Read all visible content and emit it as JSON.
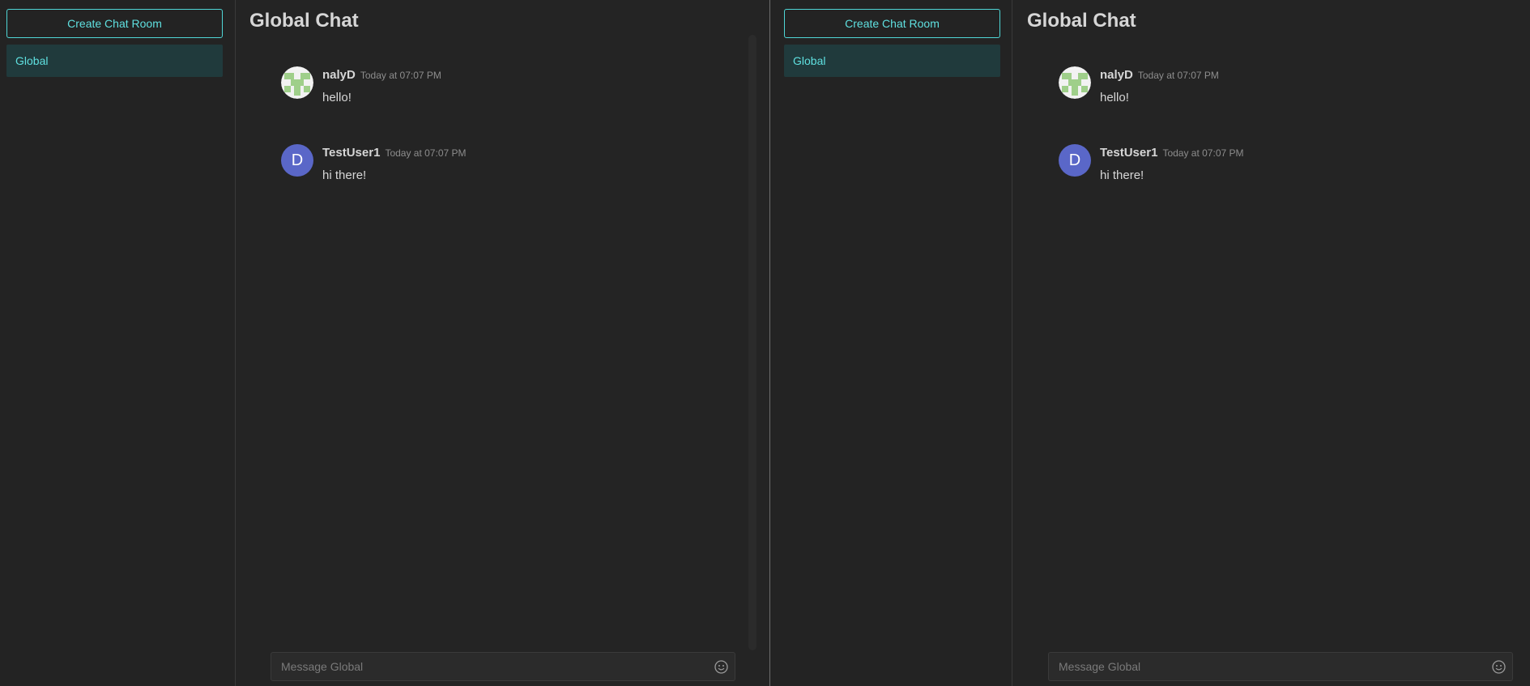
{
  "panes": [
    {
      "sidebar": {
        "create_button": "Create Chat Room",
        "rooms": [
          {
            "label": "Global"
          }
        ]
      },
      "main": {
        "title": "Global Chat",
        "messages": [
          {
            "avatar": "green-identicon",
            "user": "nalyD",
            "time": "Today at 07:07 PM",
            "text": "hello!"
          },
          {
            "avatar_letter": "D",
            "user": "TestUser1",
            "time": "Today at 07:07 PM",
            "text": "hi there!"
          }
        ],
        "composer": {
          "placeholder": "Message Global",
          "emoji_icon": "smiley-icon"
        }
      }
    },
    {
      "sidebar": {
        "create_button": "Create Chat Room",
        "rooms": [
          {
            "label": "Global"
          }
        ]
      },
      "main": {
        "title": "Global Chat",
        "messages": [
          {
            "avatar": "green-identicon",
            "user": "nalyD",
            "time": "Today at 07:07 PM",
            "text": "hello!"
          },
          {
            "avatar_letter": "D",
            "user": "TestUser1",
            "time": "Today at 07:07 PM",
            "text": "hi there!"
          }
        ],
        "composer": {
          "placeholder": "Message Global",
          "emoji_icon": "smiley-icon"
        }
      }
    }
  ],
  "colors": {
    "accent": "#5fe0e0",
    "background": "#242424",
    "selected_room": "#203a3c",
    "avatar_blue": "#5a67c8",
    "identicon_green": "#9fcf8a"
  }
}
